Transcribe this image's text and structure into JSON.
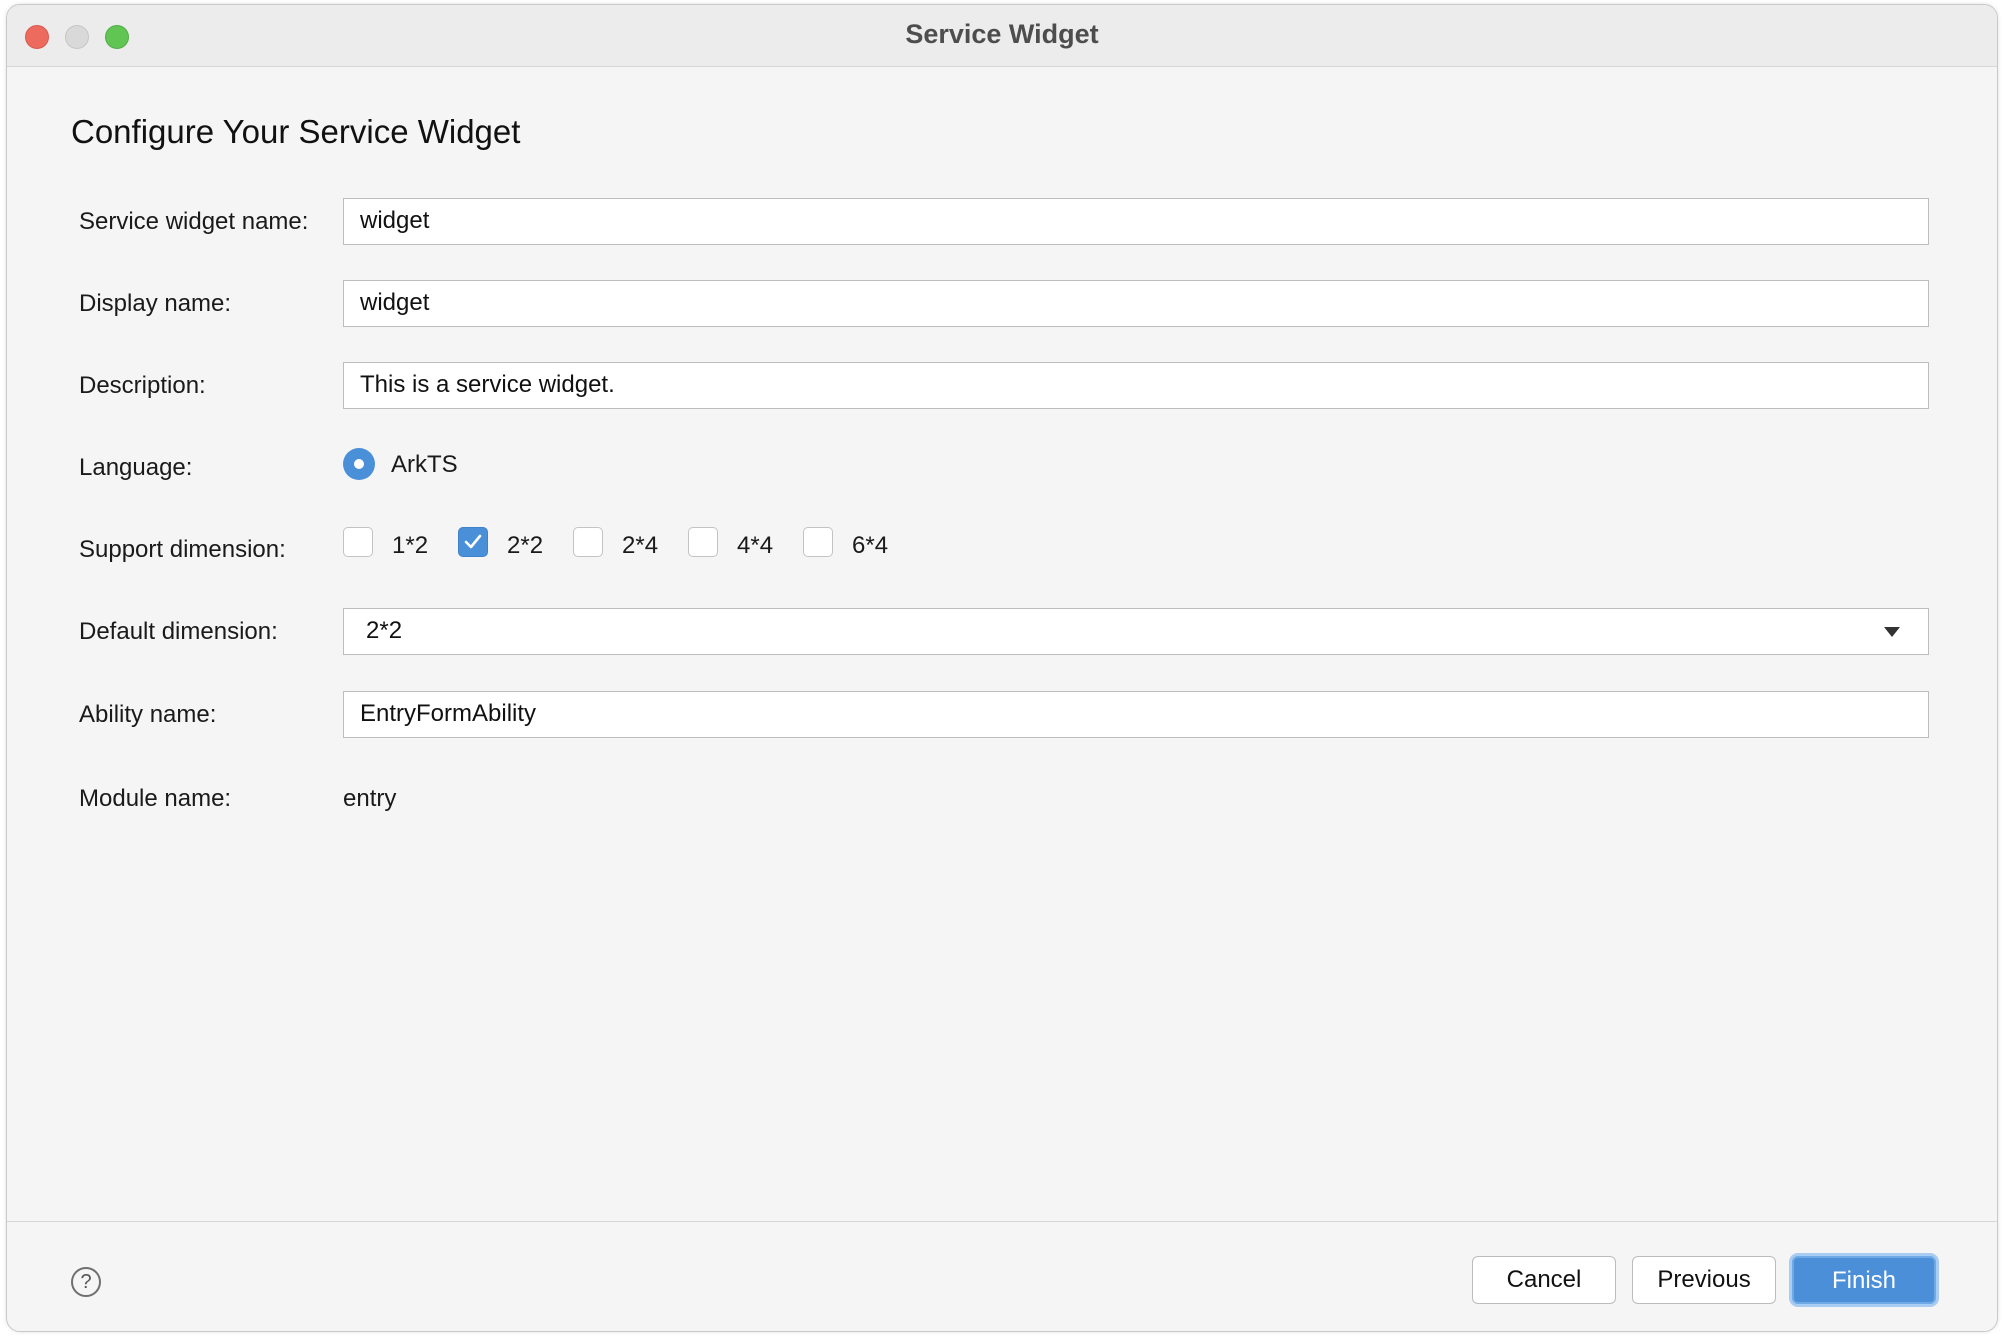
{
  "window": {
    "title": "Service Widget"
  },
  "heading": "Configure Your Service Widget",
  "form": {
    "service_widget_name": {
      "label": "Service widget name:",
      "value": "widget"
    },
    "display_name": {
      "label": "Display name:",
      "value": "widget"
    },
    "description": {
      "label": "Description:",
      "value": "This is a service widget."
    },
    "language": {
      "label": "Language:",
      "option": "ArkTS",
      "selected": true
    },
    "support_dimension": {
      "label": "Support dimension:",
      "options": [
        {
          "label": "1*2",
          "checked": false
        },
        {
          "label": "2*2",
          "checked": true
        },
        {
          "label": "2*4",
          "checked": false
        },
        {
          "label": "4*4",
          "checked": false
        },
        {
          "label": "6*4",
          "checked": false
        }
      ]
    },
    "default_dimension": {
      "label": "Default dimension:",
      "value": "2*2"
    },
    "ability_name": {
      "label": "Ability name:",
      "value": "EntryFormAbility"
    },
    "module_name": {
      "label": "Module name:",
      "value": "entry"
    }
  },
  "footer": {
    "help_glyph": "?",
    "cancel_label": "Cancel",
    "previous_label": "Previous",
    "finish_label": "Finish"
  },
  "colors": {
    "accent": "#4a90d9",
    "close": "#ed6a5e",
    "maximize": "#61c554"
  },
  "icons": {
    "help": "question-circle-icon",
    "dropdown": "triangle-down-icon",
    "check": "checkmark-icon"
  }
}
